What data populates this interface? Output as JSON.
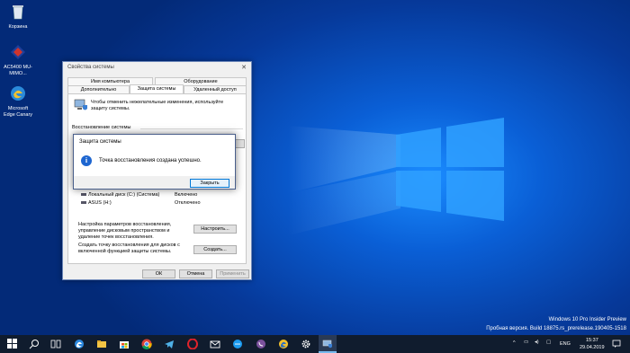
{
  "desktop": {
    "icons": [
      {
        "label": "Корзина",
        "name": "recycle-bin"
      },
      {
        "label": "AC5400 MU-MIMO...",
        "name": "ac5400-app"
      },
      {
        "label": "Microsoft Edge Canary",
        "name": "edge-canary"
      }
    ],
    "watermark": {
      "line1": "Windows 10 Pro Insider Preview",
      "line2": "Пробная версия. Build 18875.rs_prerelease.190405-1518"
    }
  },
  "window": {
    "title": "Свойства системы",
    "tabs_top": [
      "Имя компьютера",
      "Оборудование"
    ],
    "tabs_bottom": [
      "Дополнительно",
      "Защита системы",
      "Удаленный доступ"
    ],
    "intro": "Чтобы отменить нежелательные изменения, используйте защиту системы.",
    "section_restore": "Восстановление системы",
    "drives": [
      {
        "name": "Локальный диск (C:) (Система)",
        "status": "Включено"
      },
      {
        "name": "ASUS (H:)",
        "status": "Отключено"
      }
    ],
    "configure_text": "Настройка параметров восстановления, управление дисковым пространством и удаление точек восстановления.",
    "configure_button": "Настроить...",
    "create_text": "Создать точку восстановления для дисков с включенной функцией защиты системы.",
    "create_button": "Создать...",
    "ok": "ОК",
    "cancel": "Отмена",
    "apply": "Применить"
  },
  "dialog": {
    "title": "Защита системы",
    "message": "Точка восстановления создана успешно.",
    "close": "Закрыть"
  },
  "taskbar": {
    "lang": "ENG",
    "time": "15:37",
    "date": "29.04.2019",
    "colors": {
      "bar": "#101c2e",
      "accent": "#0078d7"
    }
  }
}
